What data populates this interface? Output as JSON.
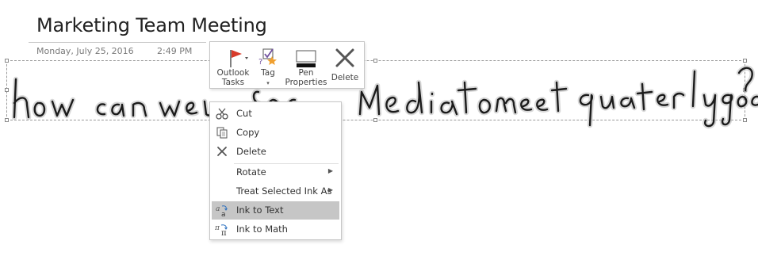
{
  "page": {
    "title": "Marketing Team Meeting",
    "date": "Monday, July 25, 2016",
    "time": "2:49 PM"
  },
  "ink": {
    "recognized_text": "how can we use social media to meet quaterly goals?"
  },
  "mini_toolbar": {
    "buttons": [
      {
        "label_line1": "Outlook",
        "label_line2": "Tasks",
        "icon": "flag-icon"
      },
      {
        "label_line1": "Tag",
        "label_line2": "▾",
        "icon": "tag-icon"
      },
      {
        "label_line1": "Pen",
        "label_line2": "Properties",
        "icon": "pen-properties-icon"
      },
      {
        "label_line1": "Delete",
        "label_line2": "",
        "icon": "delete-x-icon"
      }
    ]
  },
  "context_menu": {
    "items": [
      {
        "label": "Cut",
        "icon": "scissors-icon"
      },
      {
        "label": "Copy",
        "icon": "copy-icon"
      },
      {
        "label": "Delete",
        "icon": "delete-icon"
      },
      {
        "label": "Rotate",
        "submenu": true
      },
      {
        "label": "Treat Selected Ink As",
        "submenu": true
      },
      {
        "label": "Ink to Text",
        "icon": "ink-to-text-icon",
        "highlighted": true
      },
      {
        "label": "Ink to Math",
        "icon": "ink-to-math-icon"
      }
    ]
  },
  "colors": {
    "flag_red": "#d83b2b",
    "tag_star": "#f0a030",
    "tag_check": "#7050a0",
    "menu_highlight": "#c6c6c6"
  }
}
